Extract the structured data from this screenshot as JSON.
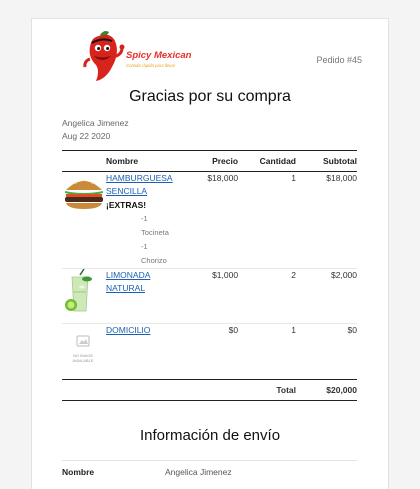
{
  "header": {
    "logo_title": "Spicy Mexican",
    "logo_tagline": "Comida rápida para llevar",
    "order_number": "Pedido #45"
  },
  "thanks_title": "Gracias por su compra",
  "customer": {
    "name": "Angelica Jimenez",
    "date": "Aug 22 2020"
  },
  "table": {
    "headers": {
      "name": "Nombre",
      "price": "Precio",
      "qty": "Cantidad",
      "subtotal": "Subtotal"
    },
    "items": [
      {
        "name": "HAMBURGUESA SENCILLA",
        "image": "burger-image",
        "price": "$18,000",
        "qty": "1",
        "subtotal": "$18,000",
        "extras_title": "¡EXTRAS!",
        "extras": [
          "-1",
          "Tocineta",
          "-1 Chorizo"
        ]
      },
      {
        "name": "LIMONADA NATURAL",
        "image": "lemonade-image",
        "price": "$1,000",
        "qty": "2",
        "subtotal": "$2,000"
      },
      {
        "name": "DOMICILIO",
        "image": "no-image-placeholder",
        "no_image_text": "NO IMAGE AVAILABLE",
        "price": "$0",
        "qty": "1",
        "subtotal": "$0"
      }
    ],
    "total_label": "Total",
    "total_value": "$20,000"
  },
  "shipping": {
    "title": "Información de envío",
    "name_label": "Nombre",
    "name_value": "Angelica Jimenez"
  },
  "colors": {
    "link": "#1a5fb4",
    "brand_red": "#e8302a",
    "brand_orange": "#e8a21a"
  }
}
